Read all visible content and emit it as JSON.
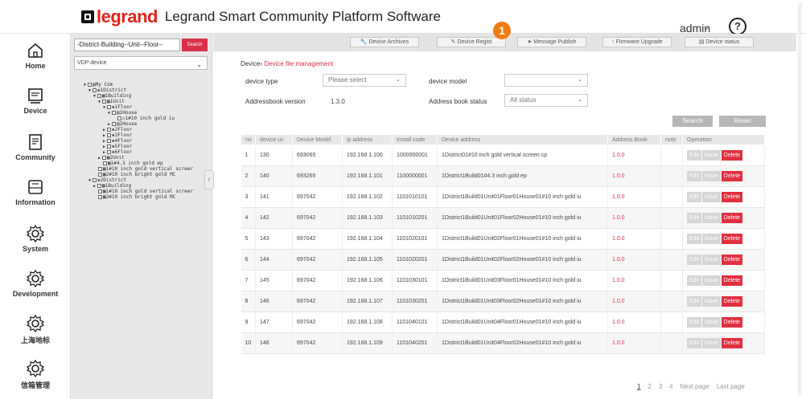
{
  "header": {
    "logo_text": "legrand",
    "title": "Legrand Smart Community Platform Software",
    "user": "admin",
    "help": "?",
    "step_badge": "1"
  },
  "nav": {
    "items": [
      {
        "label": "Home",
        "icon": "home-icon"
      },
      {
        "label": "Device",
        "icon": "device-icon"
      },
      {
        "label": "Community",
        "icon": "community-icon"
      },
      {
        "label": "Information",
        "icon": "information-icon"
      },
      {
        "label": "System",
        "icon": "system-gear-icon"
      },
      {
        "label": "Development",
        "icon": "development-gear-icon"
      },
      {
        "label": "上海地标",
        "icon": "gear-icon"
      },
      {
        "label": "信箱管理",
        "icon": "gear-icon"
      }
    ]
  },
  "tree_panel": {
    "search_value": "-District-Building--Unit--Floor--",
    "search_button": "Search",
    "device_type": "VDP device",
    "nodes": [
      "My Com",
      "1District",
      "1Building",
      "1Unit",
      "1Floor",
      "1House",
      "1#10 inch gold iu",
      "2House",
      "2Floor",
      "3Floor",
      "4Floor",
      "5Floor",
      "6Floor",
      "2Unit",
      "1#4.3 inch gold ep",
      "1#10 inch gold vertical screer",
      "2#10 inch bright gold MC",
      "2District",
      "1Building",
      "1#10 inch gold vertical screer",
      "2#10 inch bright gold MC"
    ]
  },
  "toolbar": {
    "buttons": [
      "Device Archives",
      "Device Regist",
      "Message Publish",
      "Firmware Upgrade",
      "Device status"
    ]
  },
  "breadcrumb": {
    "root": "Device",
    "current": "Device file management"
  },
  "filters": {
    "device_type_label": "device type",
    "device_type_value": "Please select",
    "device_model_label": "device model",
    "device_model_value": "",
    "addressbook_version_label": "Addressbook version",
    "addressbook_version_value": "1.3.0",
    "address_book_status_label": "Address book status",
    "address_book_status_value": "All status",
    "search_button": "Search",
    "reset_button": "Reset"
  },
  "table": {
    "columns": [
      "no",
      "device uc",
      "Device Model",
      "ip address",
      "Install code",
      "Device address",
      "Address Book",
      "note",
      "Operation"
    ],
    "op_labels": {
      "edit": "Edit",
      "issue": "Issue",
      "delete": "Delete"
    },
    "rows": [
      {
        "no": "1",
        "uc": "130",
        "model": "693065",
        "ip": "192.168.1.100",
        "code": "1000000001",
        "address": "1District01#10 inch gold vertical screen cp",
        "book": "1.0.0",
        "note": ""
      },
      {
        "no": "2",
        "uc": "140",
        "model": "693265",
        "ip": "192.168.1.101",
        "code": "1100000001",
        "address": "1District1Build01#4.3 inch gold ep",
        "book": "1.0.0",
        "note": ""
      },
      {
        "no": "3",
        "uc": "141",
        "model": "697042",
        "ip": "192.168.1.102",
        "code": "1101010101",
        "address": "1District1Build01Unit01Floor01House01#10 inch gold iu",
        "book": "1.0.0",
        "note": ""
      },
      {
        "no": "4",
        "uc": "142",
        "model": "697042",
        "ip": "192.168.1.103",
        "code": "1101010201",
        "address": "1District1Build01Unit01Floor02House01#10 inch gold iu",
        "book": "1.0.0",
        "note": ""
      },
      {
        "no": "5",
        "uc": "143",
        "model": "697042",
        "ip": "192.168.1.104",
        "code": "1101020101",
        "address": "1District1Build01Unit02Floor01House01#10 inch gold iu",
        "book": "1.0.0",
        "note": ""
      },
      {
        "no": "6",
        "uc": "144",
        "model": "697042",
        "ip": "192.168.1.105",
        "code": "1101020201",
        "address": "1District1Build01Unit02Floor02House01#10 inch gold iu",
        "book": "1.0.0",
        "note": ""
      },
      {
        "no": "7",
        "uc": "145",
        "model": "697042",
        "ip": "192.168.1.106",
        "code": "1101030101",
        "address": "1District1Build01Unit03Floor01House01#10 inch gold iu",
        "book": "1.0.0",
        "note": ""
      },
      {
        "no": "8",
        "uc": "146",
        "model": "697042",
        "ip": "192.168.1.107",
        "code": "1101030201",
        "address": "1District1Build01Unit03Floor02House01#10 inch gold iu",
        "book": "1.0.0",
        "note": ""
      },
      {
        "no": "9",
        "uc": "147",
        "model": "697042",
        "ip": "192.168.1.108",
        "code": "1101040101",
        "address": "1District1Build01Unit04Floor01House01#10 inch gold iu",
        "book": "1.0.0",
        "note": ""
      },
      {
        "no": "10",
        "uc": "148",
        "model": "697042",
        "ip": "192.168.1.109",
        "code": "1101040201",
        "address": "1District1Build01Unit04Floor02House01#10 inch gold iu",
        "book": "1.0.0",
        "note": ""
      }
    ]
  },
  "pager": {
    "pages": [
      "1",
      "2",
      "3",
      "4"
    ],
    "next": "Next page",
    "last": "Last page"
  }
}
